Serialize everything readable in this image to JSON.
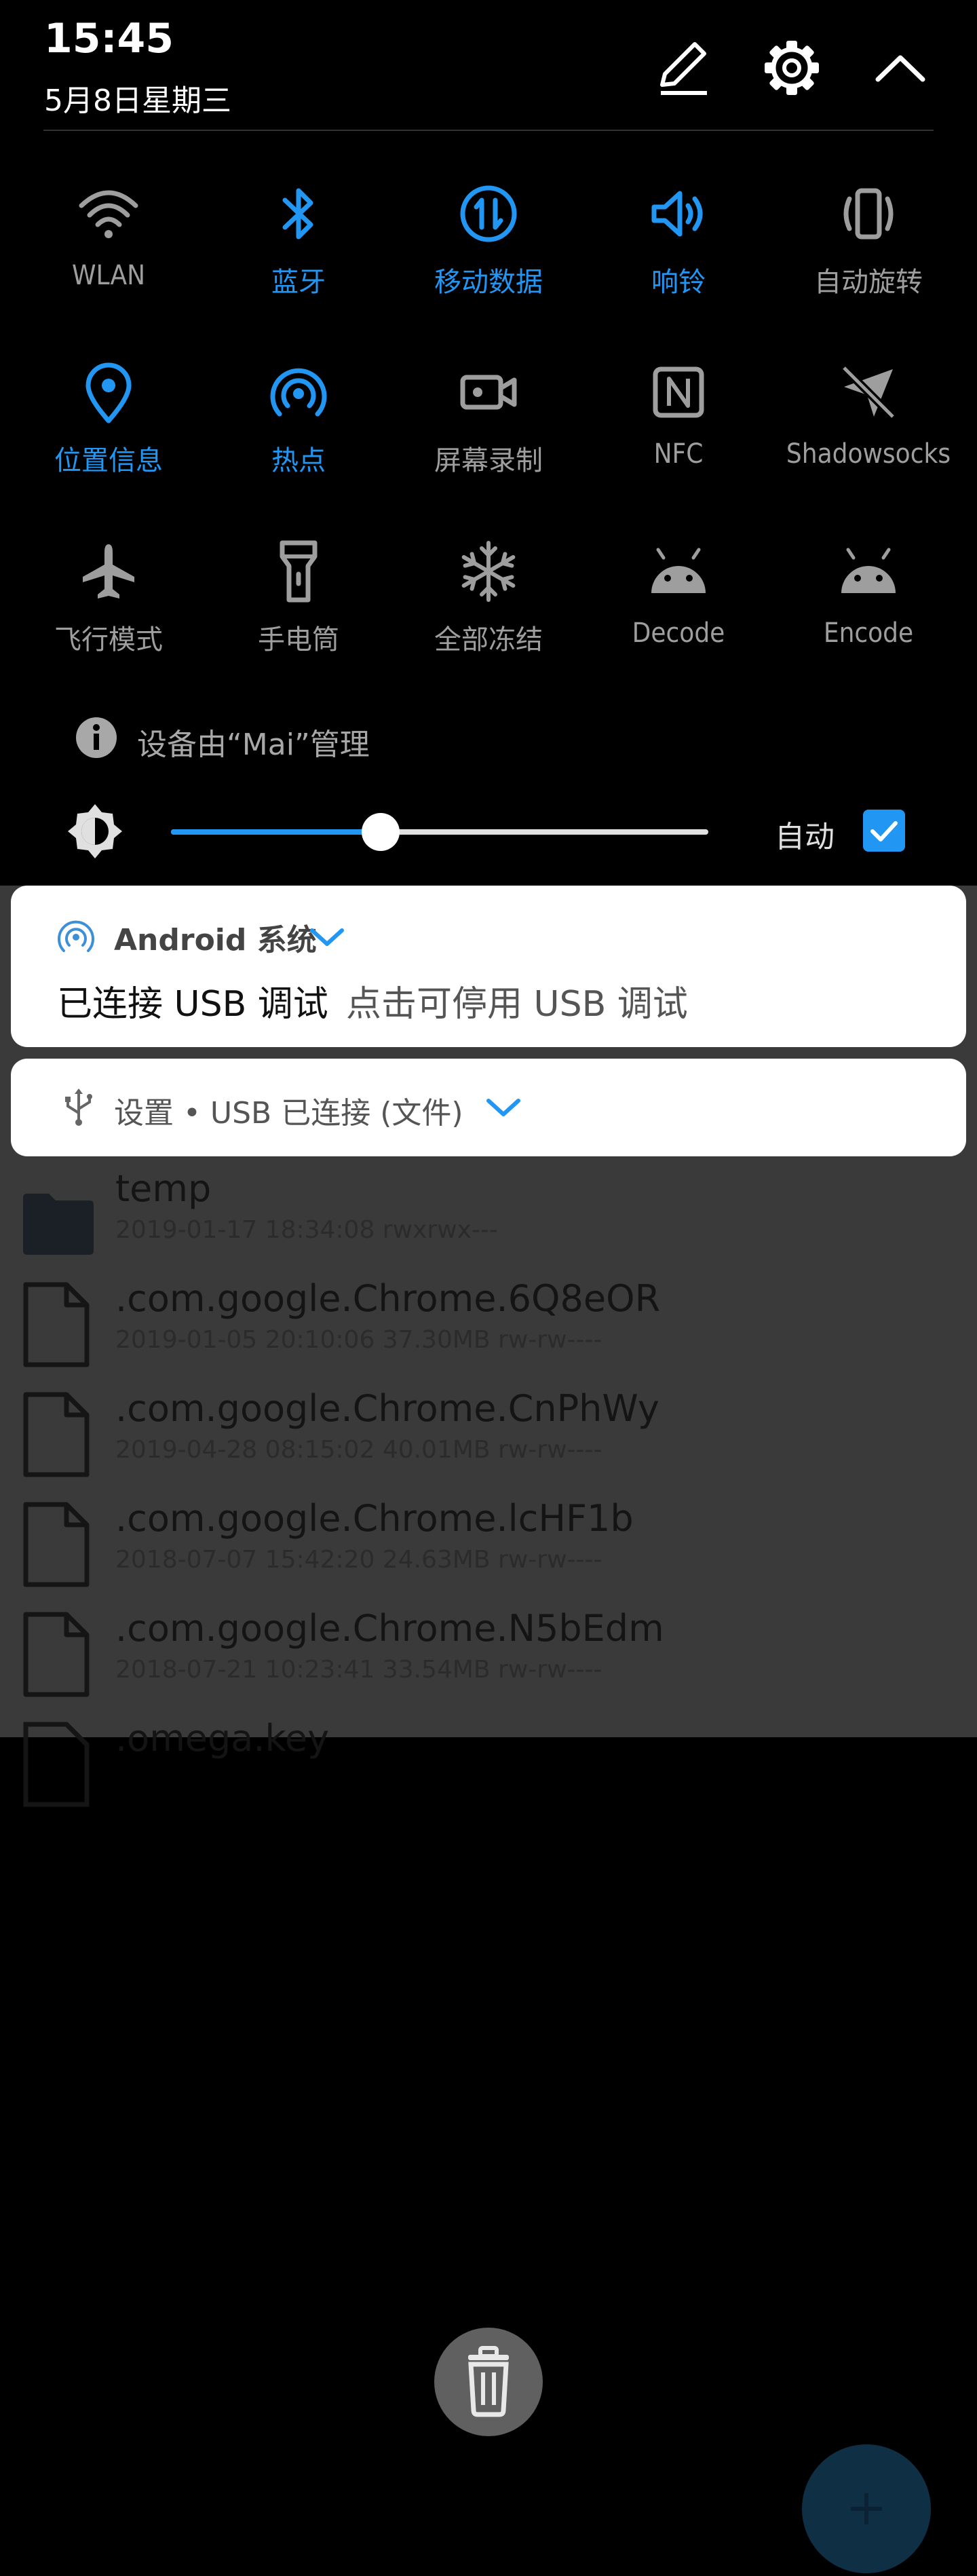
{
  "status": {
    "time": "15:45",
    "date": "5月8日星期三"
  },
  "header": {
    "edit_icon": "pencil-icon",
    "settings_icon": "gear-icon",
    "collapse_icon": "chevron-up-icon"
  },
  "tiles": [
    {
      "label": "WLAN",
      "icon": "wifi-icon",
      "active": false
    },
    {
      "label": "蓝牙",
      "icon": "bluetooth-icon",
      "active": true
    },
    {
      "label": "移动数据",
      "icon": "mobile-data-icon",
      "active": true
    },
    {
      "label": "响铃",
      "icon": "volume-icon",
      "active": true
    },
    {
      "label": "自动旋转",
      "icon": "rotate-icon",
      "active": false
    },
    {
      "label": "位置信息",
      "icon": "location-icon",
      "active": true
    },
    {
      "label": "热点",
      "icon": "hotspot-icon",
      "active": true
    },
    {
      "label": "屏幕录制",
      "icon": "screen-record-icon",
      "active": false
    },
    {
      "label": "NFC",
      "icon": "nfc-icon",
      "active": false
    },
    {
      "label": "Shadowsocks",
      "icon": "paper-plane-icon",
      "active": false
    },
    {
      "label": "飞行模式",
      "icon": "airplane-icon",
      "active": false
    },
    {
      "label": "手电筒",
      "icon": "flashlight-icon",
      "active": false
    },
    {
      "label": "全部冻结",
      "icon": "snowflake-icon",
      "active": false
    },
    {
      "label": "Decode",
      "icon": "android-icon",
      "active": false
    },
    {
      "label": "Encode",
      "icon": "android-icon",
      "active": false
    }
  ],
  "managed": {
    "text": "设备由“Mai”管理"
  },
  "brightness": {
    "level": 0.39,
    "auto_label": "自动",
    "auto_checked": true
  },
  "notifications": {
    "android": {
      "app": "Android 系统",
      "title": "已连接 USB 调试",
      "body": "点击可停用 USB 调试"
    },
    "usb": {
      "text": "设置 • USB 已连接 (文件)"
    }
  },
  "files": [
    {
      "name": "temp",
      "meta": "2019-01-17 18:34:08    rwxrwx---",
      "type": "folder"
    },
    {
      "name": ".com.google.Chrome.6Q8eOR",
      "meta": "2019-01-05 20:10:06  37.30MB  rw-rw----",
      "type": "file"
    },
    {
      "name": ".com.google.Chrome.CnPhWy",
      "meta": "2019-04-28 08:15:02  40.01MB  rw-rw----",
      "type": "file"
    },
    {
      "name": ".com.google.Chrome.lcHF1b",
      "meta": "2018-07-07 15:42:20  24.63MB  rw-rw----",
      "type": "file"
    },
    {
      "name": ".com.google.Chrome.N5bEdm",
      "meta": "2018-07-21 10:23:41  33.54MB  rw-rw----",
      "type": "file"
    },
    {
      "name": ".omega.key",
      "meta": "",
      "type": "file"
    }
  ],
  "colors": {
    "accent": "#2196f3",
    "inactive": "#9e9e9e"
  }
}
